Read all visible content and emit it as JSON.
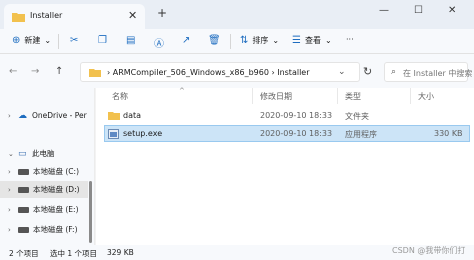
{
  "window": {
    "tab_title": "Installer",
    "new_tab": "+",
    "close_tab": "✕",
    "minimize": "—",
    "maximize": "☐",
    "close": "✕"
  },
  "toolbar": {
    "new_label": "新建",
    "new_caret": "⌄",
    "sort_label": "排序",
    "sort_caret": "⌄",
    "view_label": "查看",
    "view_caret": "⌄",
    "more": "···"
  },
  "address": {
    "back": "←",
    "forward": "→",
    "up": "↑",
    "crumbs": "›  ARMCompiler_506_Windows_x86_b960  ›  Installer",
    "dropdown": "⌄",
    "refresh": "↻",
    "search_placeholder": "在 Installer 中搜索"
  },
  "sidebar": {
    "items": [
      {
        "label": "OneDrive - Per",
        "chev": "›"
      },
      {
        "label": "此电脑",
        "chev": "⌄"
      },
      {
        "label": "本地磁盘 (C:)",
        "chev": "›"
      },
      {
        "label": "本地磁盘 (D:)",
        "chev": "›"
      },
      {
        "label": "本地磁盘 (E:)",
        "chev": "›"
      },
      {
        "label": "本地磁盘 (F:)",
        "chev": "›"
      }
    ]
  },
  "columns": {
    "name": "名称",
    "modified": "修改日期",
    "type": "类型",
    "size": "大小",
    "sort_caret": "^"
  },
  "files": [
    {
      "name": "data",
      "modified": "2020-09-10 18:33",
      "type": "文件夹",
      "size": ""
    },
    {
      "name": "setup.exe",
      "modified": "2020-09-10 18:33",
      "type": "应用程序",
      "size": "330 KB"
    }
  ],
  "status": {
    "count": "2 个项目",
    "selected": "选中 1 个项目",
    "size": "329 KB"
  },
  "watermark": "CSDN @我带你们打",
  "colors": {
    "accent": "#1e6dc0",
    "selection": "#cce4f7",
    "folder": "#f2c14e"
  }
}
